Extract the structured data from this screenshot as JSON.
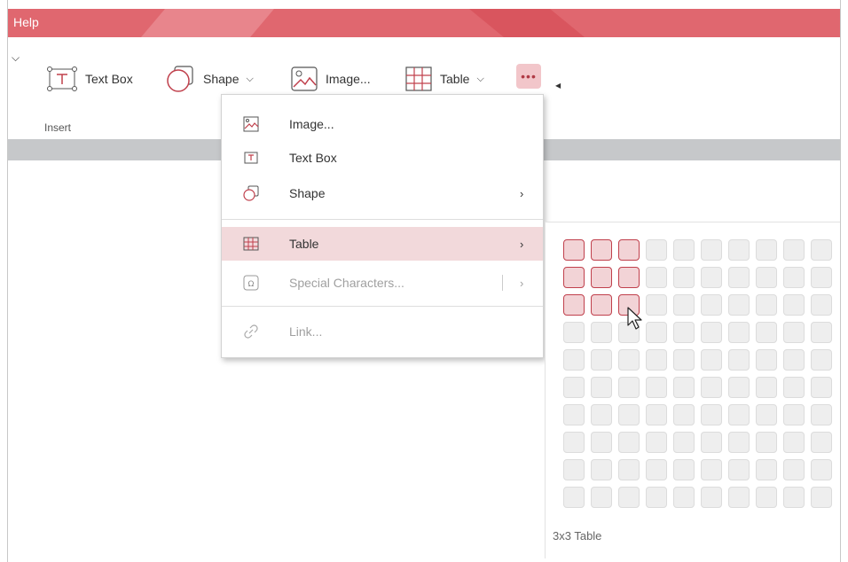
{
  "titlebar": {
    "menu_label": "Help",
    "accent": "#e0676f"
  },
  "ribbon": {
    "buttons": [
      {
        "label": "Text Box",
        "icon": "text-box-icon"
      },
      {
        "label": "Shape",
        "icon": "shape-icon"
      },
      {
        "label": "Image...",
        "icon": "image-icon"
      },
      {
        "label": "Table",
        "icon": "table-icon"
      }
    ],
    "more_icon": "ellipsis-icon",
    "group_label": "Insert"
  },
  "insert_menu": {
    "items": [
      {
        "label": "Image...",
        "icon": "image-icon",
        "has_submenu": false,
        "enabled": true
      },
      {
        "label": "Text Box",
        "icon": "text-box-icon",
        "has_submenu": false,
        "enabled": true
      },
      {
        "label": "Shape",
        "icon": "shape-icon",
        "has_submenu": true,
        "enabled": true
      },
      {
        "label": "Table",
        "icon": "table-icon",
        "has_submenu": true,
        "enabled": true,
        "highlighted": true
      },
      {
        "label": "Special Characters...",
        "icon": "omega-icon",
        "has_submenu": true,
        "enabled": false
      },
      {
        "label": "Link...",
        "icon": "link-icon",
        "has_submenu": false,
        "enabled": false
      }
    ]
  },
  "table_picker": {
    "columns": 10,
    "rows": 10,
    "selected_columns": 3,
    "selected_rows": 3,
    "status": "3x3 Table",
    "selected_color": "#c0404c"
  }
}
